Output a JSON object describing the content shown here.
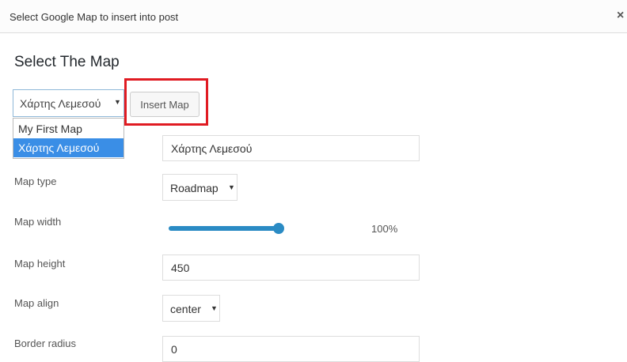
{
  "dialog": {
    "title": "Select Google Map to insert into post",
    "close_icon": "×"
  },
  "heading": "Select The Map",
  "map_select": {
    "selected": "Χάρτης Λεμεσού",
    "arrow": "▼",
    "options": [
      "My First Map",
      "Χάρτης Λεμεσού"
    ]
  },
  "insert_button": "Insert Map",
  "highlight_color": "#e01b22",
  "fields": {
    "map_name_value": "Χάρτης Λεμεσού",
    "map_type_label": "Map type",
    "map_type_value": "Roadmap",
    "map_width_label": "Map width",
    "map_width_value": "100%",
    "map_width_fraction": 1.0,
    "map_height_label": "Map height",
    "map_height_value": "450",
    "map_align_label": "Map align",
    "map_align_value": "center",
    "border_radius_label": "Border radius",
    "border_radius_value": "0"
  },
  "accent_color": "#2a8bc4"
}
